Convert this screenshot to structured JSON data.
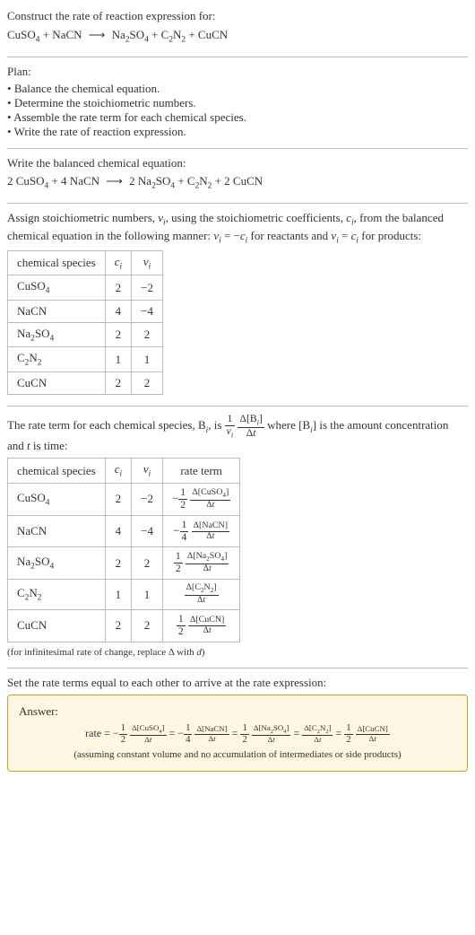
{
  "intro": {
    "prompt": "Construct the rate of reaction expression for:",
    "r1": "CuSO",
    "r1_sub": "4",
    "plus1": " + NaCN ",
    "arrow": "⟶",
    "p1": " Na",
    "p1_sub": "2",
    "p2": "SO",
    "p2_sub": "4",
    "plus2": " + C",
    "p3_sub": "2",
    "p4": "N",
    "p4_sub": "2",
    "plus3": " + CuCN"
  },
  "plan": {
    "label": "Plan:",
    "items": [
      "Balance the chemical equation.",
      "Determine the stoichiometric numbers.",
      "Assemble the rate term for each chemical species.",
      "Write the rate of reaction expression."
    ]
  },
  "balanced": {
    "label": "Write the balanced chemical equation:",
    "c1": "2 CuSO",
    "s1": "4",
    "t2": " + 4 NaCN ",
    "arrow": "⟶",
    "t3": " 2 Na",
    "s2": "2",
    "t4": "SO",
    "s3": "4",
    "t5": " + C",
    "s4": "2",
    "t6": "N",
    "s5": "2",
    "t7": " + 2 CuCN"
  },
  "stoich": {
    "intro1": "Assign stoichiometric numbers, ",
    "nu": "ν",
    "i": "i",
    "intro2": ", using the stoichiometric coefficients, ",
    "c": "c",
    "intro3": ", from the balanced chemical equation in the following manner: ",
    "eq_react": " = −",
    "intro4": " for reactants and ",
    "eq_prod": " = ",
    "intro5": " for products:",
    "headers": [
      "chemical species",
      "c",
      "ν"
    ],
    "rows": [
      {
        "name": "CuSO",
        "sub": "4",
        "c": "2",
        "nu": "−2"
      },
      {
        "name": "NaCN",
        "sub": "",
        "c": "4",
        "nu": "−4"
      },
      {
        "name": "Na",
        "sub": "2",
        "name2": "SO",
        "sub2": "4",
        "c": "2",
        "nu": "2"
      },
      {
        "name": "C",
        "sub": "2",
        "name2": "N",
        "sub2": "2",
        "c": "1",
        "nu": "1"
      },
      {
        "name": "CuCN",
        "sub": "",
        "c": "2",
        "nu": "2"
      }
    ]
  },
  "rateterm": {
    "intro1": "The rate term for each chemical species, B",
    "intro2": ", is ",
    "intro3": " where [B",
    "intro4": "] is the amount concentration and ",
    "t": "t",
    "intro5": " is time:",
    "num1": "1",
    "den1_nu": "ν",
    "num2_d": "Δ[B",
    "num2_end": "]",
    "den2": "Δt",
    "headers": [
      "chemical species",
      "c",
      "ν",
      "rate term"
    ],
    "rows": [
      {
        "name": "CuSO",
        "sub": "4",
        "c": "2",
        "nu": "−2",
        "sign": "−",
        "fn": "1",
        "fd": "2",
        "dn": "Δ[CuSO",
        "dn_sub": "4",
        "dn_end": "]",
        "dd": "Δt"
      },
      {
        "name": "NaCN",
        "sub": "",
        "c": "4",
        "nu": "−4",
        "sign": "−",
        "fn": "1",
        "fd": "4",
        "dn": "Δ[NaCN]",
        "dn_sub": "",
        "dn_end": "",
        "dd": "Δt"
      },
      {
        "name": "Na",
        "sub": "2",
        "name2": "SO",
        "sub2": "4",
        "c": "2",
        "nu": "2",
        "sign": "",
        "fn": "1",
        "fd": "2",
        "dn": "Δ[Na",
        "dn_sub": "2",
        "dn_mid": "SO",
        "dn_sub2": "4",
        "dn_end": "]",
        "dd": "Δt"
      },
      {
        "name": "C",
        "sub": "2",
        "name2": "N",
        "sub2": "2",
        "c": "1",
        "nu": "1",
        "sign": "",
        "fn": "",
        "fd": "",
        "dn": "Δ[C",
        "dn_sub": "2",
        "dn_mid": "N",
        "dn_sub2": "2",
        "dn_end": "]",
        "dd": "Δt"
      },
      {
        "name": "CuCN",
        "sub": "",
        "c": "2",
        "nu": "2",
        "sign": "",
        "fn": "1",
        "fd": "2",
        "dn": "Δ[CuCN]",
        "dn_sub": "",
        "dn_end": "",
        "dd": "Δt"
      }
    ],
    "note": "(for infinitesimal rate of change, replace Δ with ",
    "d": "d",
    "note_end": ")"
  },
  "final": {
    "intro": "Set the rate terms equal to each other to arrive at the rate expression:",
    "answer_label": "Answer:",
    "rate": "rate = ",
    "terms": [
      {
        "sign": "−",
        "fn": "1",
        "fd": "2",
        "dn": "Δ[CuSO",
        "dsub": "4",
        "dend": "]",
        "dd": "Δt"
      },
      {
        "sign": "−",
        "fn": "1",
        "fd": "4",
        "dn": "Δ[NaCN]",
        "dsub": "",
        "dend": "",
        "dd": "Δt"
      },
      {
        "sign": "",
        "fn": "1",
        "fd": "2",
        "dn": "Δ[Na",
        "dsub": "2",
        "dmid": "SO",
        "dsub2": "4",
        "dend": "]",
        "dd": "Δt"
      },
      {
        "sign": "",
        "fn": "",
        "fd": "",
        "dn": "Δ[C",
        "dsub": "2",
        "dmid": "N",
        "dsub2": "2",
        "dend": "]",
        "dd": "Δt"
      },
      {
        "sign": "",
        "fn": "1",
        "fd": "2",
        "dn": "Δ[CuCN]",
        "dsub": "",
        "dend": "",
        "dd": "Δt"
      }
    ],
    "eq": " = ",
    "assumption": "(assuming constant volume and no accumulation of intermediates or side products)"
  }
}
